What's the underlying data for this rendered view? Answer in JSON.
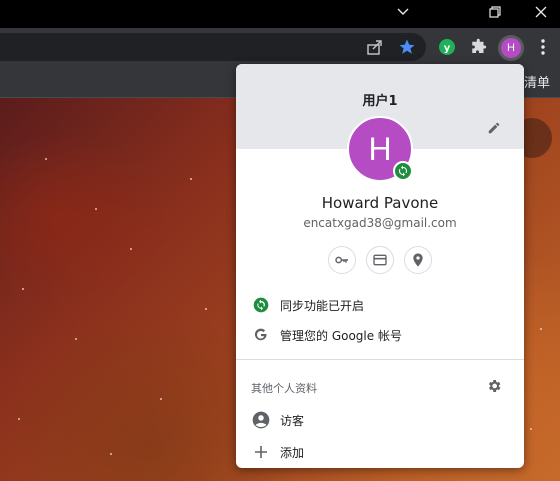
{
  "window": {
    "controls": [
      {
        "name": "chevron-down-icon"
      },
      {
        "name": "restore-icon"
      },
      {
        "name": "close-icon"
      }
    ]
  },
  "toolbar": {
    "icons": [
      "share-icon",
      "bookmark-star-icon",
      "extension-y-icon",
      "puzzle-icon",
      "profile-avatar",
      "more-vert-icon"
    ],
    "profile_initial": "H",
    "star_color": "#4c8df6",
    "avatar_color": "#b54cc4"
  },
  "bookmarks_bar": {
    "visible_text": "读清单"
  },
  "profile_menu": {
    "title": "用户1",
    "avatar_initial": "H",
    "name": "Howard Pavone",
    "email": "encatxgad38@gmail.com",
    "quick_actions": [
      "key-icon",
      "credit-card-icon",
      "location-pin-icon"
    ],
    "sync_status": "同步功能已开启",
    "manage_account": "管理您的 Google 帐号",
    "other_profiles_label": "其他个人资料",
    "guest_label": "访客",
    "add_label": "添加",
    "accent_green": "#1e8e3e"
  }
}
